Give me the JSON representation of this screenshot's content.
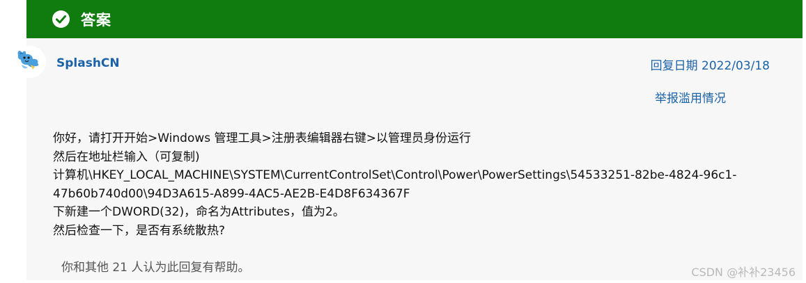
{
  "banner": {
    "title": "答案",
    "icon": "check-circle-icon"
  },
  "answer": {
    "author": "SplashCN",
    "avatar_icon": "dragon-avatar-icon",
    "reply_date_label": "回复日期 2022/03/18",
    "report_label": "举报滥用情况",
    "body_lines": [
      "你好，请打开开始>Windows 管理工具>注册表编辑器右键>以管理员身份运行",
      "然后在地址栏输入（可复制)",
      "计算机\\HKEY_LOCAL_MACHINE\\SYSTEM\\CurrentControlSet\\Control\\Power\\PowerSettings\\54533251-82be-4824-96c1-",
      "47b60b740d00\\94D3A615-A899-4AC5-AE2B-E4D8F634367F",
      "下新建一个DWORD(32)，命名为Attributes，值为2。",
      "然后检查一下，是否有系统散热?"
    ],
    "helpful_text": "你和其他 21 人认为此回复有帮助。"
  },
  "watermark": "CSDN @补补23456",
  "colors": {
    "banner": "#107c10",
    "link": "#1b62a8",
    "card": "#f7f7f7"
  }
}
